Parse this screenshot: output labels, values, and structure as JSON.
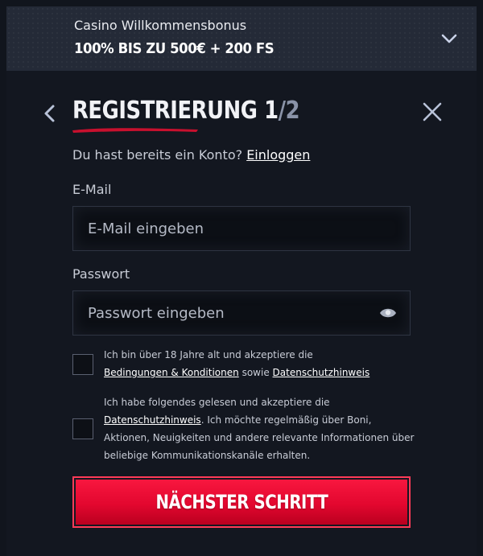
{
  "bonus": {
    "subtitle": "Casino Willkommensbonus",
    "title": "100% BIS ZU 500€ + 200 FS"
  },
  "header": {
    "title": "REGISTRIERUNG 1",
    "step_sep": "/",
    "step_total": "2"
  },
  "login": {
    "prompt": "Du hast bereits ein Konto?",
    "link": "Einloggen"
  },
  "email": {
    "label": "E-Mail",
    "placeholder": "E-Mail eingeben",
    "value": ""
  },
  "password": {
    "label": "Passwort",
    "placeholder": "Passwort eingeben",
    "value": ""
  },
  "consent_age": {
    "text_1": "Ich bin über 18 Jahre alt und akzeptiere die",
    "link_terms": "Bedingungen & Konditionen",
    "text_2": "sowie",
    "link_privacy": "Datenschutzhinweis"
  },
  "consent_marketing": {
    "text_1": "Ich habe folgendes gelesen und akzeptiere die",
    "link_privacy": "Datenschutzhinweis",
    "text_2": ". Ich möchte regelmäßig über Boni, Aktionen, Neuigkeiten und andere relevante Informationen über beliebige Kommunikationskanäle erhalten."
  },
  "next_button": {
    "label": "NÄCHSTER SCHRITT"
  },
  "colors": {
    "accent": "#e3072f",
    "background": "#131720",
    "bonus_bar": "#242a37"
  },
  "icons": {
    "bonus_toggle": "chevron-down-icon",
    "back": "chevron-left-icon",
    "close": "close-icon",
    "password_toggle": "eye-icon"
  }
}
